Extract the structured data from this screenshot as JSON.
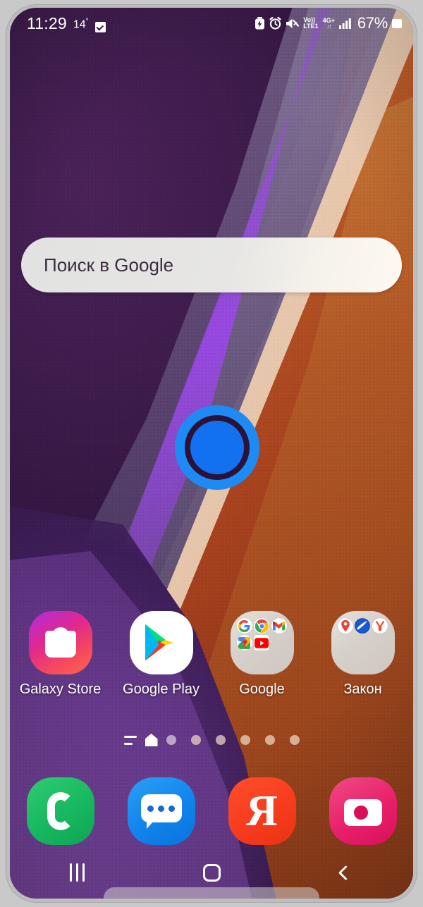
{
  "status_bar": {
    "time": "11:29",
    "temperature": "14",
    "degree": "°",
    "task_icon": "checkbox-checked-icon",
    "icons": [
      {
        "name": "power-saving-icon",
        "label": ""
      },
      {
        "name": "alarm-icon",
        "label": ""
      },
      {
        "name": "mute-icon",
        "label": ""
      }
    ],
    "volte_top": "Vo))",
    "volte_bottom": "LTE1",
    "network_label": "4G+",
    "network_arrows": "↓↑",
    "signal_icon": "signal-bars-icon",
    "battery_percent": "67%",
    "battery_icon": "battery-icon"
  },
  "search": {
    "placeholder": "Поиск в Google",
    "value": ""
  },
  "widget": {
    "name": "blue-circle-widget",
    "outer_color": "#1e8bf5",
    "inner_color": "#1271f0"
  },
  "apps": [
    {
      "label": "Galaxy Store",
      "icon": "galaxy-store-icon",
      "type": "app"
    },
    {
      "label": "Google Play",
      "icon": "google-play-icon",
      "type": "app"
    },
    {
      "label": "Google",
      "icon": "folder-icon",
      "type": "folder",
      "contents": [
        "google-icon",
        "chrome-icon",
        "gmail-icon",
        "google-maps-icon",
        "youtube-icon"
      ]
    },
    {
      "label": "Закон",
      "icon": "folder-icon",
      "type": "folder",
      "contents": [
        "maps-pin-icon",
        "blue-disc-icon",
        "yandex-browser-icon"
      ]
    }
  ],
  "page_indicator": {
    "apps_list_icon": "app-list-lines-icon",
    "home_icon": "home-page-icon",
    "current_index": 0,
    "dots": 6
  },
  "dock": [
    {
      "label": "Phone",
      "icon": "phone-icon",
      "color": "#17b85f"
    },
    {
      "label": "Messages",
      "icon": "messages-icon",
      "color": "#1184ec"
    },
    {
      "label": "Yandex",
      "icon": "yandex-icon",
      "glyph": "Я",
      "color": "#f73c1e"
    },
    {
      "label": "Camera",
      "icon": "camera-icon",
      "color": "#e8206a"
    }
  ],
  "nav_bar": {
    "recents_icon": "recents-icon",
    "home_icon": "home-icon",
    "back_icon": "back-icon"
  }
}
